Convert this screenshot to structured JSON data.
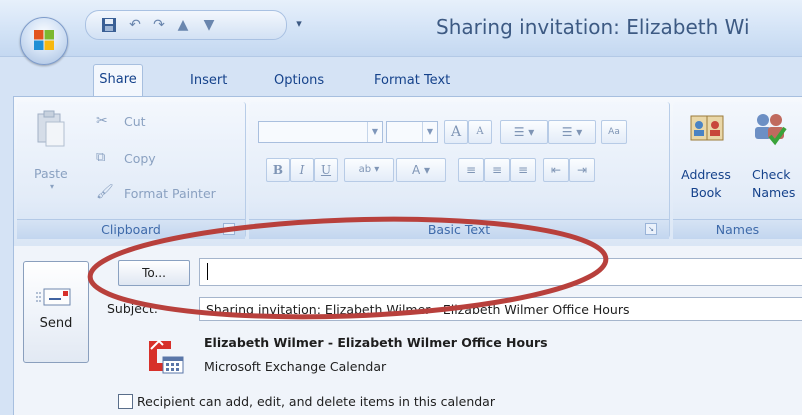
{
  "window": {
    "title": "Sharing invitation: Elizabeth Wi"
  },
  "qat": {
    "icons": [
      "save-icon",
      "undo-icon",
      "redo-icon",
      "previous-item-icon",
      "next-item-icon",
      "customize-dropdown-icon"
    ]
  },
  "tabs": [
    {
      "label": "Share",
      "active": true
    },
    {
      "label": "Insert"
    },
    {
      "label": "Options"
    },
    {
      "label": "Format Text"
    }
  ],
  "ribbon": {
    "clipboard": {
      "label": "Clipboard",
      "paste": "Paste",
      "cut": "Cut",
      "copy": "Copy",
      "format_painter": "Format Painter"
    },
    "basic_text": {
      "label": "Basic Text",
      "bold": "B",
      "italic": "I",
      "underline": "U",
      "grow_font": "A",
      "shrink_font": "A",
      "font_color": "A"
    },
    "names": {
      "label": "Names",
      "address_book_line1": "Address",
      "address_book_line2": "Book",
      "check_names_line1": "Check",
      "check_names_line2": "Names"
    }
  },
  "message": {
    "send_label": "Send",
    "to_label": "To...",
    "to_value": "",
    "subject_label": "Subject:",
    "subject_value": "Sharing invitation: Elizabeth Wilmer - Elizabeth Wilmer Office Hours",
    "calendar_name": "Elizabeth Wilmer - Elizabeth Wilmer Office Hours",
    "calendar_type": "Microsoft Exchange Calendar",
    "permission_checkbox_label": "Recipient can add, edit, and delete items in this calendar",
    "permission_checked": false
  },
  "colors": {
    "annotation_ellipse": "#b8403c",
    "ribbon_text": "#15428b",
    "group_label_text": "#3e6aaa"
  }
}
